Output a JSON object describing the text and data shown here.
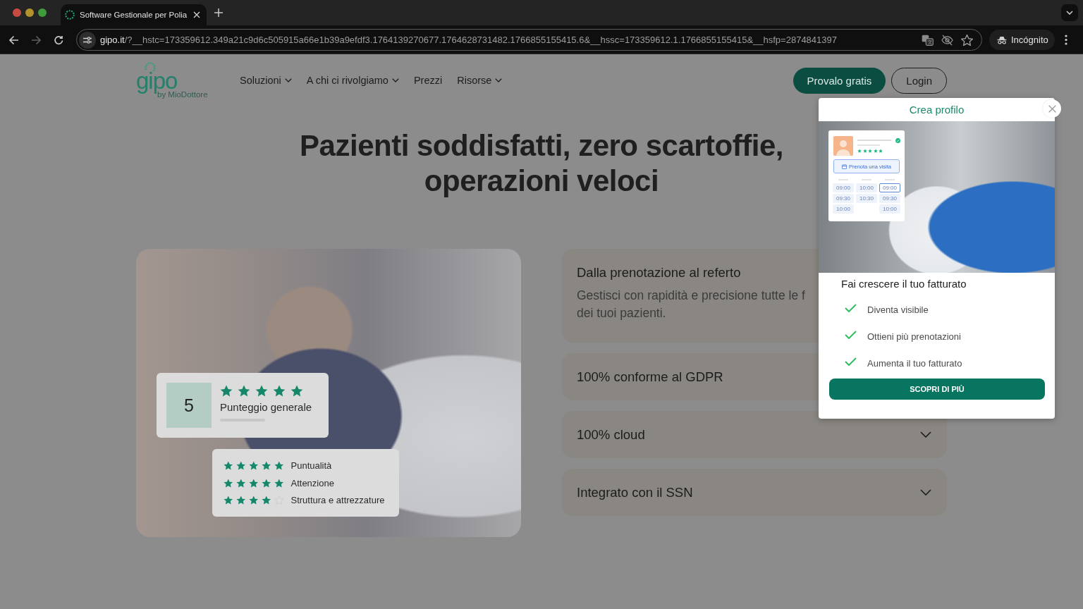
{
  "browser": {
    "tab": {
      "title": "Software Gestionale per Polia",
      "loading": true
    },
    "toolbar": [
      {
        "kind": "back",
        "disabled": false
      },
      {
        "kind": "forward",
        "disabled": true
      },
      {
        "kind": "reload",
        "disabled": false
      }
    ],
    "url": {
      "host": "gipo.it",
      "path": "/?__hstc=173359612.349a21c9d6c505915a66e1b39a9efdf3.1764139270677.1764628731482.1766855155415.6&__hssc=173359612.1.1766855155415&__hsfp=2874841397"
    },
    "bookmarked": false,
    "profile": {
      "label": "Incógnito"
    }
  },
  "header": {
    "logo": {
      "wordmark": "gipo",
      "tagline": "by MioDottore"
    },
    "nav": [
      {
        "label": "Soluzioni",
        "dropdown": true
      },
      {
        "label": "A chi ci rivolgiamo",
        "dropdown": true
      },
      {
        "label": "Prezzi",
        "dropdown": false
      },
      {
        "label": "Risorse",
        "dropdown": true
      }
    ],
    "buttons": [
      {
        "label": "Provalo gratis",
        "kind": "primary"
      },
      {
        "label": "Login",
        "kind": "outline"
      }
    ]
  },
  "hero": {
    "title": "Pazienti soddisfatti, zero scartoffie, operazioni veloci"
  },
  "ratings": {
    "overall": {
      "score": "5",
      "stars": 5,
      "label": "Punteggio generale"
    },
    "categories": [
      {
        "label": "Puntualità",
        "stars": 5
      },
      {
        "label": "Attenzione",
        "stars": 5
      },
      {
        "label": "Struttura e attrezzature",
        "stars": 4
      }
    ]
  },
  "features": [
    {
      "title": "Dalla prenotazione al referto",
      "expanded": true,
      "body": [
        "Gestisci con rapidità e precisione tutte le f",
        "dei tuoi pazienti."
      ]
    },
    {
      "title": "100% conforme al GDPR",
      "expanded": false
    },
    {
      "title": "100% cloud",
      "expanded": false
    },
    {
      "title": "Integrato con il SSN",
      "expanded": false
    }
  ],
  "popup": {
    "title": "Crea profilo",
    "booking_card": {
      "stars": 5,
      "button": "Prenota una visita",
      "columns": [
        {
          "slots": [
            {
              "time": "09:00",
              "selected": false
            },
            {
              "time": "09:30",
              "selected": false
            },
            {
              "time": "10:00",
              "selected": false
            }
          ]
        },
        {
          "slots": [
            {
              "time": "10:00",
              "selected": false
            },
            {
              "time": "10:30",
              "selected": false
            }
          ]
        },
        {
          "slots": [
            {
              "time": "09:00",
              "selected": true
            },
            {
              "time": "09:30",
              "selected": false
            },
            {
              "time": "10:00",
              "selected": false
            }
          ]
        }
      ]
    },
    "heading": "Fai crescere il tuo fatturato",
    "benefits": [
      "Diventa visibile",
      "Ottieni più prenotazioni",
      "Aumenta il tuo fatturato"
    ],
    "button": "SCOPRI DI PIÙ"
  }
}
